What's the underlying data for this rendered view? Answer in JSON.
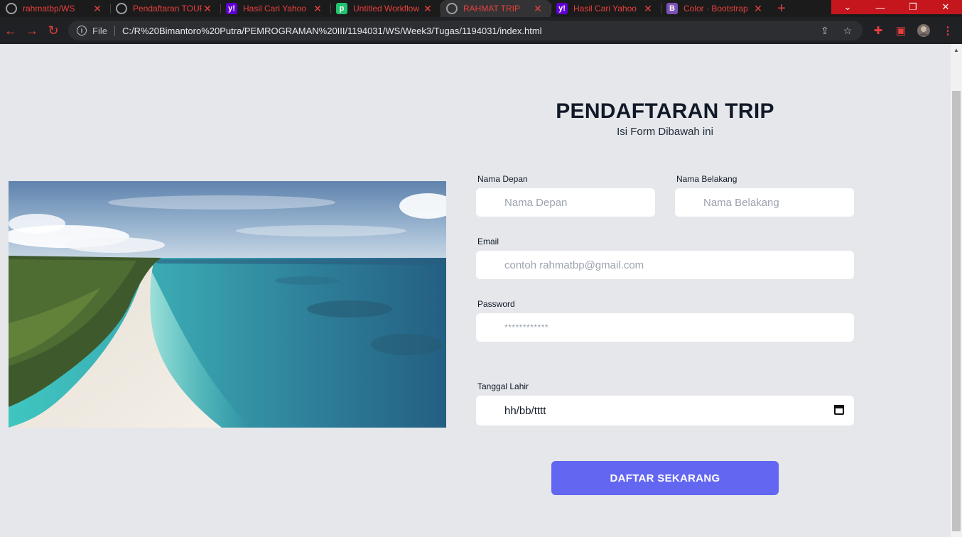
{
  "browser": {
    "tabs": [
      {
        "title": "rahmatbp/WS",
        "icon": "github-icon",
        "active": false
      },
      {
        "title": "Pendaftaran TOUR",
        "icon": "globe-icon",
        "active": false
      },
      {
        "title": "Hasil Cari Yahoo",
        "icon": "yahoo-icon",
        "active": false
      },
      {
        "title": "Untitled Workflow",
        "icon": "pipedream-icon",
        "active": false
      },
      {
        "title": "RAHMAT TRIP",
        "icon": "globe-icon",
        "active": true
      },
      {
        "title": "Hasil Cari Yahoo",
        "icon": "yahoo-icon",
        "active": false
      },
      {
        "title": "Color · Bootstrap",
        "icon": "bootstrap-icon",
        "active": false
      }
    ],
    "tab_close_glyph": "✕",
    "new_tab_glyph": "+",
    "address": {
      "scheme_label": "File",
      "url": "C:/R%20Bimantoro%20Putra/PEMROGRAMAN%20III/1194031/WS/Week3/Tugas/1194031/index.html"
    },
    "accent_color": "#e8403e"
  },
  "page": {
    "title": "PENDAFTARAN TRIP",
    "subtitle": "Isi Form Dibawah ini",
    "image": {
      "description_icon": "beach-image"
    },
    "form": {
      "first_name": {
        "label": "Nama Depan",
        "placeholder": "Nama Depan"
      },
      "last_name": {
        "label": "Nama Belakang",
        "placeholder": "Nama Belakang"
      },
      "email": {
        "label": "Email",
        "placeholder": "contoh rahmatbp@gmail.com"
      },
      "password": {
        "label": "Password",
        "placeholder": "************"
      },
      "birth_date": {
        "label": "Tanggal Lahir",
        "value": "hh/bb/tttt"
      },
      "submit_label": "DAFTAR SEKARANG"
    },
    "colors": {
      "background": "#e5e7eb",
      "button": "#6366f1",
      "heading": "#111827"
    }
  }
}
